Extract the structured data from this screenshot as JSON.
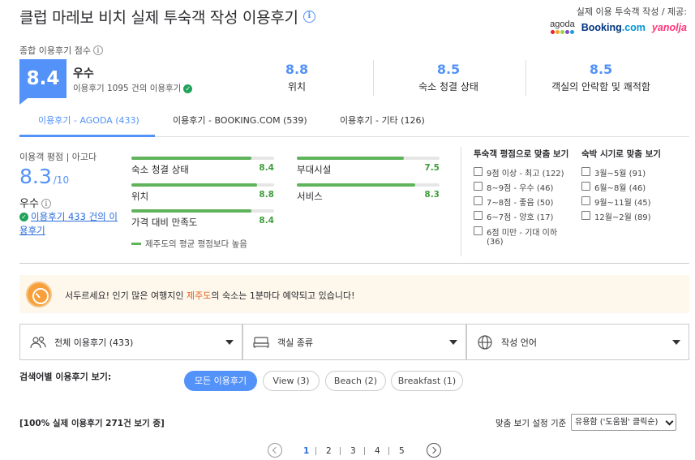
{
  "header": {
    "title": "클럽 마레보 비치 실제 투숙객 작성 이용후기",
    "provided_by": "실제 이용 투숙객 작성 / 제공:",
    "logos": {
      "agoda": "agoda",
      "booking": "Booking",
      "booking_tld": ".com",
      "yanolja": "yanolja"
    }
  },
  "overall": {
    "label": "종합 이용후기 점수",
    "score": "8.4",
    "word": "우수",
    "count_text": "이용후기 1095 건의 이용후기",
    "accent": "#5392f9"
  },
  "sub_scores": [
    {
      "value": "8.8",
      "label": "위치"
    },
    {
      "value": "8.5",
      "label": "숙소 청결 상태"
    },
    {
      "value": "8.5",
      "label": "객실의 안락함 및 쾌적함"
    }
  ],
  "tabs": [
    {
      "label": "이용후기 - AGODA (433)",
      "active": true
    },
    {
      "label": "이용후기 - BOOKING.COM (539)",
      "active": false
    },
    {
      "label": "이용후기 - 기타 (126)",
      "active": false
    }
  ],
  "guest": {
    "label": "이용객 평점 | 아고다",
    "score": "8.3",
    "out_of": "/10",
    "word": "우수",
    "link": "이용후기 433 건의 이용후기"
  },
  "bars": [
    {
      "label": "숙소 청결 상태",
      "value": "8.4",
      "fill": 0.84
    },
    {
      "label": "위치",
      "value": "8.8",
      "fill": 0.88
    },
    {
      "label": "가격 대비 만족도",
      "value": "8.4",
      "fill": 0.84
    },
    {
      "label": "부대시설",
      "value": "7.5",
      "fill": 0.75
    },
    {
      "label": "서비스",
      "value": "8.3",
      "fill": 0.83
    }
  ],
  "bar_legend": "제주도의 평균 평점보다 높음",
  "filters": {
    "rating_title": "투숙객 평점으로 맞춤 보기",
    "rating_options": [
      "9점 이상 - 최고 (122)",
      "8~9점 - 우수 (46)",
      "7~8점 - 좋음 (50)",
      "6~7점 - 양호 (17)",
      "6점 미만 - 기대 이하",
      "(36)"
    ],
    "season_title": "숙박 시기로 맞춤 보기",
    "season_options": [
      "3월~5월 (91)",
      "6월~8월 (46)",
      "9월~11월 (45)",
      "12월~2월 (89)"
    ]
  },
  "alert": {
    "before": "서두르세요! 인기 많은 여행지인 ",
    "highlight": "제주도",
    "after": "의 숙소는 1분마다 예약되고 있습니다!"
  },
  "dropdowns": [
    {
      "icon": "people-icon",
      "label": "전체 이용후기 (433)"
    },
    {
      "icon": "bed-icon",
      "label": "객실 종류"
    },
    {
      "icon": "globe-icon",
      "label": "작성 언어"
    }
  ],
  "keywords": {
    "label": "검색어별 이용후기 보기:",
    "chips": [
      "모든 이용후기",
      "View (3)",
      "Beach (2)",
      "Breakfast (1)"
    ]
  },
  "list": {
    "showing": "[100% 실제 이용후기 271건 보기 중]",
    "sort_label": "맞춤 보기 설정 기준",
    "sort_value": "유용함 ('도움됨' 클릭순)"
  },
  "pagination": {
    "pages": [
      "1",
      "2",
      "3",
      "4",
      "5"
    ],
    "current": "1"
  }
}
